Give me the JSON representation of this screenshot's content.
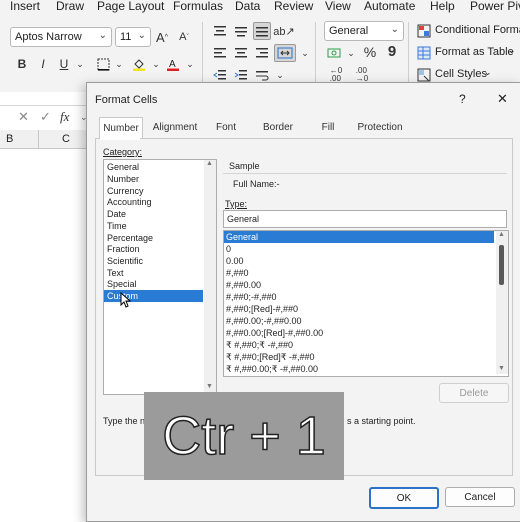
{
  "ribbon": {
    "menu": [
      "Insert",
      "Draw",
      "Page Layout",
      "Formulas",
      "Data",
      "Review",
      "View",
      "Automate",
      "Help",
      "Power Pivo"
    ],
    "font_name": "Aptos Narrow",
    "font_size": "11",
    "number_format": "General",
    "bold": "B",
    "italic": "I",
    "underline": "U",
    "conditional_formatting": "Conditional Format",
    "format_as_table": "Format as Table",
    "cell_styles": "Cell Styles",
    "percent": "%",
    "comma": "9"
  },
  "sheet": {
    "fx": "fx",
    "col_b": "B",
    "col_c": "C"
  },
  "dialog": {
    "title": "Format Cells",
    "help": "?",
    "close": "✕",
    "tabs": [
      "Number",
      "Alignment",
      "Font",
      "Border",
      "Fill",
      "Protection"
    ],
    "category_label": "Category:",
    "categories": [
      "General",
      "Number",
      "Currency",
      "Accounting",
      "Date",
      "Time",
      "Percentage",
      "Fraction",
      "Scientific",
      "Text",
      "Special",
      "Custom"
    ],
    "selected_category": "Custom",
    "sample_label": "Sample",
    "sample_value": "Full Name:-",
    "type_label": "Type:",
    "type_value": "General",
    "types": [
      "General",
      "0",
      "0.00",
      "#,##0",
      "#,##0.00",
      "#,##0;-#,##0",
      "#,##0;[Red]-#,##0",
      "#,##0.00;-#,##0.00",
      "#,##0.00;[Red]-#,##0.00",
      "₹ #,##0;₹ -#,##0",
      "₹ #,##0;[Red]₹ -#,##0",
      "₹ #,##0.00;₹ -#,##0.00"
    ],
    "delete_button": "Delete",
    "hint_left": "Type the n",
    "hint_right": "s a starting point.",
    "ok_button": "OK",
    "cancel_button": "Cancel"
  },
  "overlay": {
    "text": "Ctr + 1"
  }
}
